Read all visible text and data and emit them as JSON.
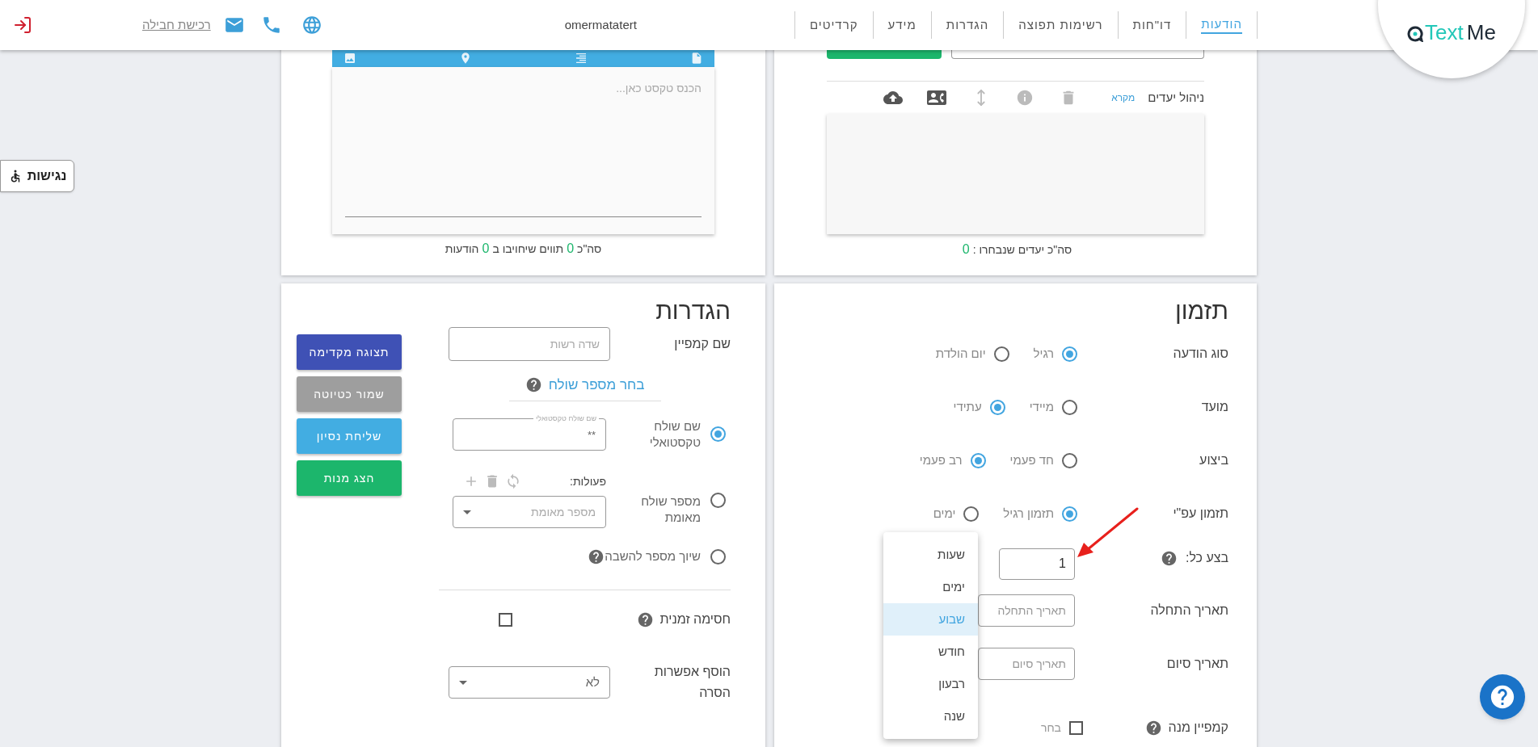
{
  "header": {
    "logo": {
      "part_a": "Text",
      "part_b": "Me"
    },
    "nav": [
      {
        "label": "הודעות",
        "selected": true
      },
      {
        "label": "דו\"חות",
        "selected": false
      },
      {
        "label": "רשימות תפוצה",
        "selected": false
      },
      {
        "label": "הגדרות",
        "selected": false
      },
      {
        "label": "מידע",
        "selected": false
      },
      {
        "label": "קרדיטים",
        "selected": false
      }
    ],
    "username": "omermatatert",
    "buy_link": "רכישת חבילה"
  },
  "accessibility_button": "נגישות",
  "recipients": {
    "label": "ניהול יעדים",
    "legend_link": "מקרא",
    "summary": [
      {
        "text": "סה\"כ יעדים שנבחרו :",
        "kind": "text"
      },
      {
        "text": "0",
        "kind": "number"
      }
    ]
  },
  "editor": {
    "placeholder": "הכנס טקסט כאן...",
    "summary": [
      {
        "text": "סה\"כ",
        "kind": "text"
      },
      {
        "text": "0",
        "kind": "number"
      },
      {
        "text": "תווים שיחויבו ב",
        "kind": "text"
      },
      {
        "text": "0",
        "kind": "number"
      },
      {
        "text": "הודעות",
        "kind": "text"
      }
    ]
  },
  "scheduling": {
    "title": "תזמון",
    "radio_rows": [
      {
        "label": "סוג הודעה",
        "options": [
          {
            "label": "רגיל",
            "selected": true
          },
          {
            "label": "יום הולדת",
            "selected": false
          }
        ]
      },
      {
        "label": "מועד",
        "options": [
          {
            "label": "מיידי",
            "selected": false
          },
          {
            "label": "עתידי",
            "selected": true
          }
        ]
      },
      {
        "label": "ביצוע",
        "options": [
          {
            "label": "חד פעמי",
            "selected": false
          },
          {
            "label": "רב פעמי",
            "selected": true
          }
        ]
      },
      {
        "label": "תזמון עפ\"י",
        "options": [
          {
            "label": "תזמון רגיל",
            "selected": true
          },
          {
            "label": "ימים",
            "selected": false
          }
        ]
      }
    ],
    "repeat": {
      "label": "בצע כל:",
      "value": "1"
    },
    "start_date": {
      "label": "תאריך התחלה",
      "placeholder": "תאריך התחלה"
    },
    "end_date": {
      "label": "תאריך סיום",
      "placeholder": "תאריך סיום"
    },
    "batch_campaign": {
      "label": "קמפיין מנה",
      "checkbox_label": "בחר",
      "checked": false
    },
    "unit_menu": [
      {
        "label": "שעות",
        "selected": false
      },
      {
        "label": "ימים",
        "selected": false
      },
      {
        "label": "שבוע",
        "selected": true
      },
      {
        "label": "חודש",
        "selected": false
      },
      {
        "label": "רבעון",
        "selected": false
      },
      {
        "label": "שנה",
        "selected": false
      }
    ]
  },
  "settings": {
    "title": "הגדרות",
    "campaign_name": {
      "label": "שם קמפיין",
      "placeholder": "שדה רשות"
    },
    "sender_link": "בחר מספר שולח",
    "sender_options": [
      {
        "kind": "text_field",
        "label": "שם שולח טקסטואלי",
        "selected": true,
        "field_label": "שם שולח טקסטואלי",
        "value": "**"
      },
      {
        "kind": "select",
        "label": "מספר שולח מאומת",
        "selected": false,
        "actions_label": "פעולות:",
        "placeholder": "מספר מאומת"
      },
      {
        "kind": "plain",
        "label": "שיוך מספר להשבה",
        "selected": false
      }
    ],
    "temporary_block": {
      "label": "חסימה זמנית",
      "checked": false
    },
    "removal_option": {
      "label": "הוסף אפשרות הסרה",
      "value": "לא"
    },
    "buttons": [
      {
        "label": "תצוגה מקדימה",
        "color": "#3f51b5"
      },
      {
        "label": "שמור כטיוטה",
        "color": "#9e9e9e"
      },
      {
        "label": "שליחת נסיון",
        "color": "#42ade2"
      },
      {
        "label": "הצג מנות",
        "color": "#1cb66c"
      }
    ]
  }
}
